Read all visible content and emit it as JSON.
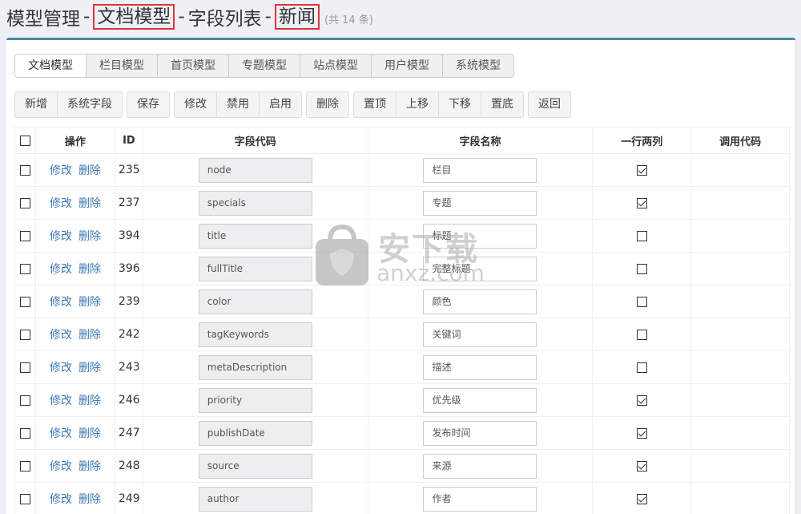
{
  "header": {
    "title_prefix": "模型管理",
    "separator": "-",
    "model_name": "文档模型",
    "title_middle": "字段列表",
    "category": "新闻",
    "count_text": "(共 14 条)"
  },
  "tabs": [
    {
      "label": "文档模型",
      "active": true
    },
    {
      "label": "栏目模型",
      "active": false
    },
    {
      "label": "首页模型",
      "active": false
    },
    {
      "label": "专题模型",
      "active": false
    },
    {
      "label": "站点模型",
      "active": false
    },
    {
      "label": "用户模型",
      "active": false
    },
    {
      "label": "系统模型",
      "active": false
    }
  ],
  "toolbar": {
    "add": "新增",
    "system_fields": "系统字段",
    "save": "保存",
    "edit": "修改",
    "disable": "禁用",
    "enable": "启用",
    "delete": "删除",
    "top": "置顶",
    "move_up": "上移",
    "move_down": "下移",
    "bottom": "置底",
    "back": "返回"
  },
  "table": {
    "headers": {
      "operation": "操作",
      "id": "ID",
      "field_code": "字段代码",
      "field_name": "字段名称",
      "two_columns": "一行两列",
      "call_code": "调用代码"
    },
    "edit_label": "修改",
    "delete_label": "删除",
    "rows": [
      {
        "id": "235",
        "code": "node",
        "name": "栏目",
        "two_columns": true
      },
      {
        "id": "237",
        "code": "specials",
        "name": "专题",
        "two_columns": true
      },
      {
        "id": "394",
        "code": "title",
        "name": "标题",
        "two_columns": false
      },
      {
        "id": "396",
        "code": "fullTitle",
        "name": "完整标题",
        "two_columns": false
      },
      {
        "id": "239",
        "code": "color",
        "name": "颜色",
        "two_columns": false
      },
      {
        "id": "242",
        "code": "tagKeywords",
        "name": "关键词",
        "two_columns": false
      },
      {
        "id": "243",
        "code": "metaDescription",
        "name": "描述",
        "two_columns": false
      },
      {
        "id": "246",
        "code": "priority",
        "name": "优先级",
        "two_columns": true
      },
      {
        "id": "247",
        "code": "publishDate",
        "name": "发布时间",
        "two_columns": true
      },
      {
        "id": "248",
        "code": "source",
        "name": "来源",
        "two_columns": true
      },
      {
        "id": "249",
        "code": "author",
        "name": "作者",
        "two_columns": true
      }
    ]
  },
  "watermark": {
    "text": "安下载",
    "url": "anxz.com"
  }
}
